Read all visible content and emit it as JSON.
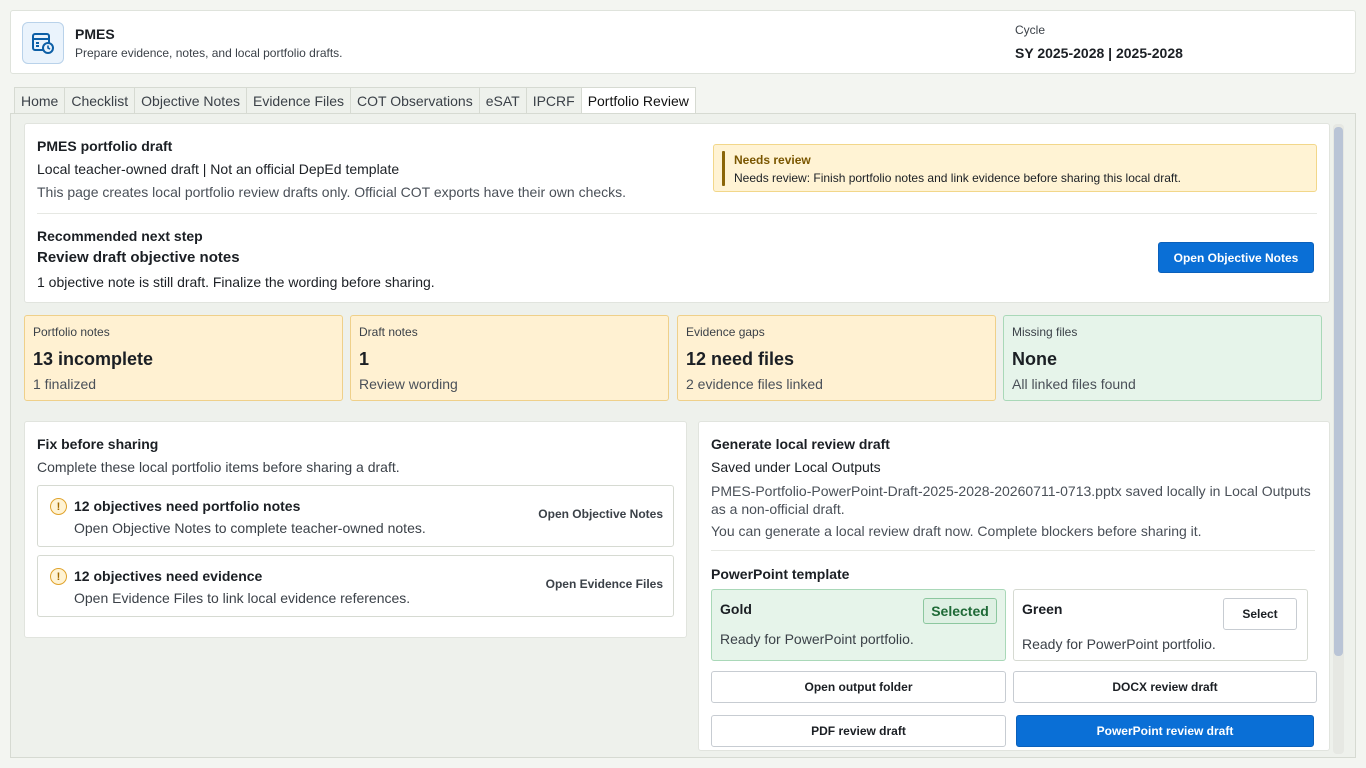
{
  "header": {
    "app_name": "PMES",
    "app_subtitle": "Prepare evidence, notes, and local portfolio drafts.",
    "cycle_label": "Cycle",
    "cycle_value": "SY 2025-2028 | 2025-2028",
    "logo_icon": "calendar-clock-icon"
  },
  "tabs": [
    {
      "label": "Home",
      "active": false
    },
    {
      "label": "Checklist",
      "active": false
    },
    {
      "label": "Objective Notes",
      "active": false
    },
    {
      "label": "Evidence Files",
      "active": false
    },
    {
      "label": "COT Observations",
      "active": false
    },
    {
      "label": "eSAT",
      "active": false
    },
    {
      "label": "IPCRF",
      "active": false
    },
    {
      "label": "Portfolio Review",
      "active": true
    }
  ],
  "intro": {
    "title": "PMES portfolio draft",
    "subtitle": "Local teacher-owned draft | Not an official DepEd template",
    "note": "This page creates local portfolio review drafts only. Official COT exports have their own checks.",
    "alert_title": "Needs review",
    "alert_text": "Needs review: Finish portfolio notes and link evidence before sharing this local draft.",
    "rec_label": "Recommended next step",
    "rec_title": "Review draft objective notes",
    "rec_desc": "1 objective note is still draft. Finalize the wording before sharing.",
    "rec_button": "Open Objective Notes"
  },
  "stats": [
    {
      "label": "Portfolio notes",
      "value": "13 incomplete",
      "sub": "1 finalized",
      "status": "warn"
    },
    {
      "label": "Draft notes",
      "value": "1",
      "sub": "Review wording",
      "status": "warn"
    },
    {
      "label": "Evidence gaps",
      "value": "12 need files",
      "sub": "2 evidence files linked",
      "status": "warn"
    },
    {
      "label": "Missing files",
      "value": "None",
      "sub": "All linked files found",
      "status": "ok"
    }
  ],
  "fix": {
    "title": "Fix before sharing",
    "subtitle": "Complete these local portfolio items before sharing a draft.",
    "items": [
      {
        "icon_text": "!",
        "title": "12 objectives need portfolio notes",
        "desc": "Open Objective Notes to complete teacher-owned notes.",
        "link": "Open Objective Notes"
      },
      {
        "icon_text": "!",
        "title": "12 objectives need evidence",
        "desc": "Open Evidence Files to link local evidence references.",
        "link": "Open Evidence Files"
      }
    ]
  },
  "generate": {
    "title": "Generate local review draft",
    "saved": "Saved under Local Outputs",
    "file_text": "PMES-Portfolio-PowerPoint-Draft-2025-2028-20260711-0713.pptx saved locally in Local Outputs as a non-official draft.",
    "note": "You can generate a local review draft now. Complete blockers before sharing it.",
    "template_label": "PowerPoint template",
    "templates": [
      {
        "name": "Gold",
        "desc": "Ready for PowerPoint portfolio.",
        "badge": "Selected"
      },
      {
        "name": "Green",
        "desc": "Ready for PowerPoint portfolio.",
        "button": "Select"
      }
    ],
    "buttons": {
      "open_folder": "Open output folder",
      "docx": "DOCX review draft",
      "pdf": "PDF review draft",
      "pptx": "PowerPoint review draft"
    }
  },
  "colors": {
    "accent": "#0a6fd6",
    "warn_bg": "#fff1d2",
    "ok_bg": "#e6f4ea"
  }
}
